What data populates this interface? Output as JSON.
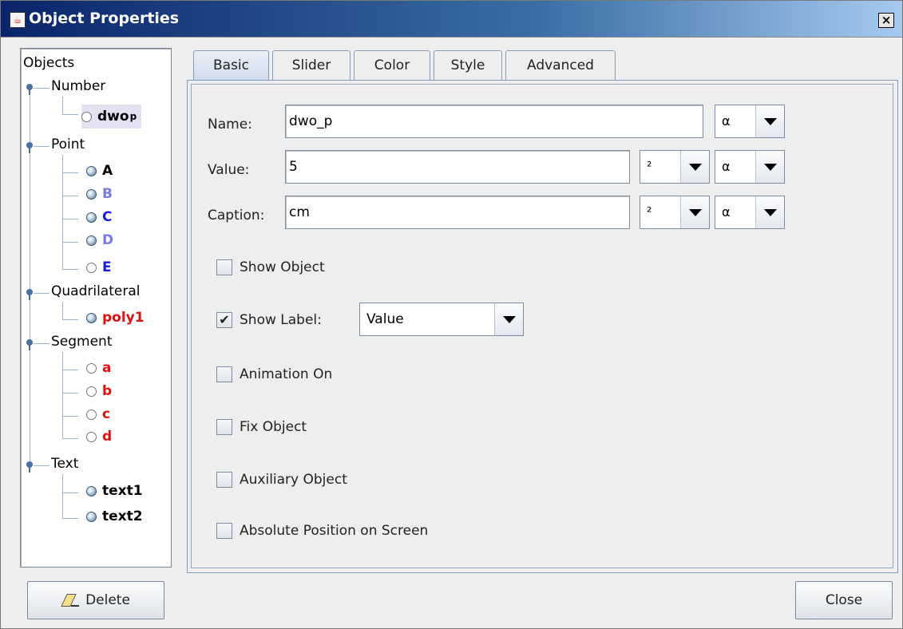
{
  "window": {
    "title": "Object Properties",
    "close_glyph": "×"
  },
  "tree": {
    "root": "Objects",
    "categories": {
      "number": "Number",
      "point": "Point",
      "quadrilateral": "Quadrilateral",
      "segment": "Segment",
      "text": "Text"
    },
    "items": {
      "dwo_base": "dwo",
      "dwo_sub": "p",
      "A": "A",
      "B": "B",
      "C": "C",
      "D": "D",
      "E": "E",
      "poly1": "poly1",
      "a": "a",
      "b": "b",
      "c": "c",
      "d": "d",
      "text1": "text1",
      "text2": "text2"
    },
    "colors": {
      "blue": "#1a1adc",
      "lightblue": "#7a7ae0",
      "red": "#e01010",
      "black": "#000000"
    }
  },
  "tabs": [
    "Basic",
    "Slider",
    "Color",
    "Style",
    "Advanced"
  ],
  "form": {
    "name_label": "Name:",
    "name_value": "dwo_p",
    "value_label": "Value:",
    "value_value": "5",
    "caption_label": "Caption:",
    "caption_value": "cm",
    "alpha": "α",
    "sup2": "²",
    "show_object": "Show Object",
    "show_label": "Show Label:",
    "show_label_value": "Value",
    "animation_on": "Animation On",
    "fix_object": "Fix Object",
    "auxiliary_object": "Auxiliary Object",
    "absolute_position": "Absolute Position on Screen",
    "check_mark": "✔"
  },
  "buttons": {
    "delete": "Delete",
    "close": "Close"
  },
  "icons": {
    "title": "java-cup-icon",
    "delete": "eraser-icon"
  }
}
